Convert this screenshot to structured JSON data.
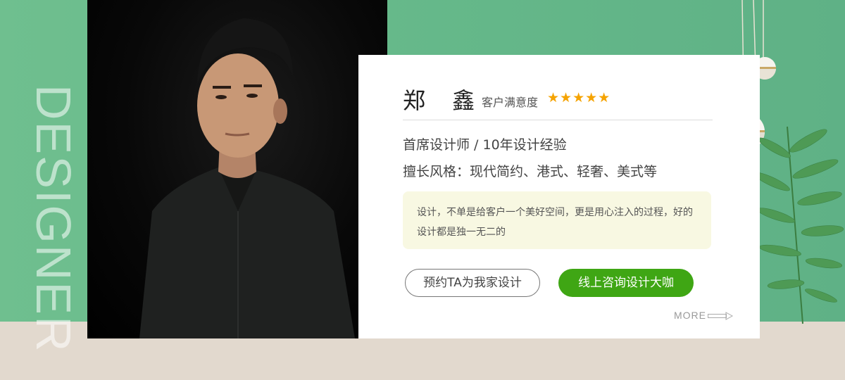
{
  "side_text": "DESIGNER",
  "designer": {
    "name": "郑  鑫",
    "satisfaction_label": "客户满意度",
    "rating_stars": "★★★★★",
    "rating": 5,
    "title_line": "首席设计师 / 10年设计经验",
    "style_line": "擅长风格：现代简约、港式、轻奢、美式等",
    "quote": "设计，不单是给客户一个美好空间，更是用心注入的过程，好的设计都是独一无二的"
  },
  "actions": {
    "book_label": "预约TA为我家设计",
    "consult_label": "线上咨询设计大咖",
    "more_label": "MORE"
  },
  "colors": {
    "green_bg": "#66b98a",
    "beige_bg": "#e2d9ce",
    "accent_green": "#3fa614",
    "star": "#f5a300",
    "quote_bg": "#f8f8e2"
  },
  "icons": [
    "arrow-right-icon",
    "star-icon",
    "pendant-lamp",
    "plant-leaves"
  ]
}
